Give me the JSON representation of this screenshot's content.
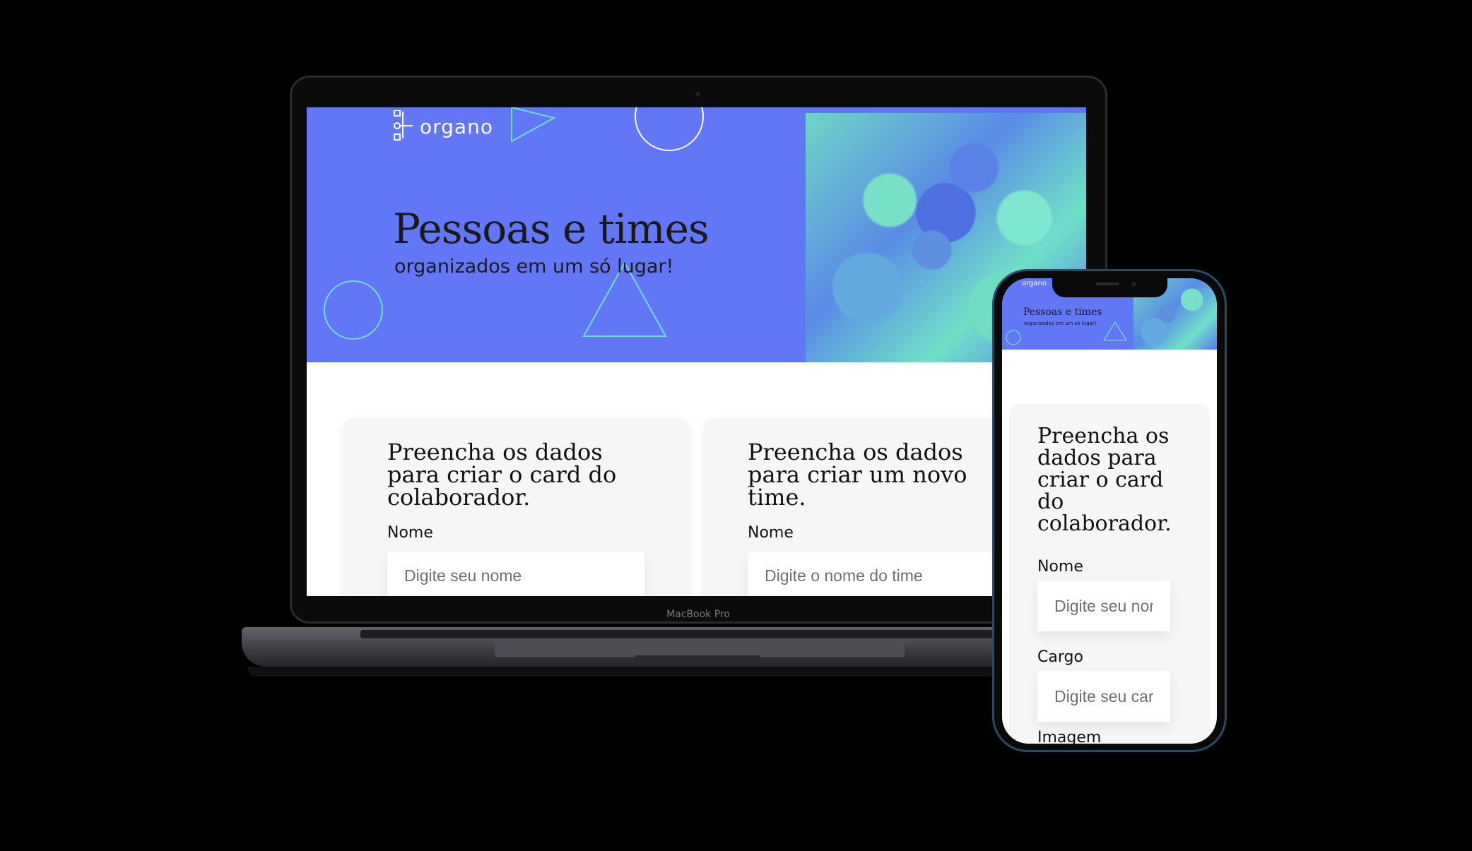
{
  "laptop": {
    "brand_label": "MacBook Pro",
    "logo_text": "organo",
    "banner_title": "Pessoas e times",
    "banner_subtitle": "organizados em um só lugar!",
    "card_1": {
      "title": "Preencha os dados para criar o card do colaborador.",
      "field_label": "Nome",
      "field_placeholder": "Digite seu nome"
    },
    "card_2": {
      "title": "Preencha os dados para criar um novo time.",
      "field_label": "Nome",
      "field_placeholder": "Digite o nome do time"
    }
  },
  "phone": {
    "logo_text": "organo",
    "banner_title": "Pessoas e times",
    "banner_subtitle": "organizados em um só lugar!",
    "card_title": "Preencha os dados para criar o card do colaborador.",
    "fields": [
      {
        "label": "Nome",
        "placeholder": "Digite seu nome"
      },
      {
        "label": "Cargo",
        "placeholder": "Digite seu cargo"
      },
      {
        "label": "Imagem"
      }
    ]
  },
  "colors": {
    "banner_blue": "#6277f5",
    "accent_teal": "#6fe0c8",
    "card_bg": "#f6f6f6"
  }
}
